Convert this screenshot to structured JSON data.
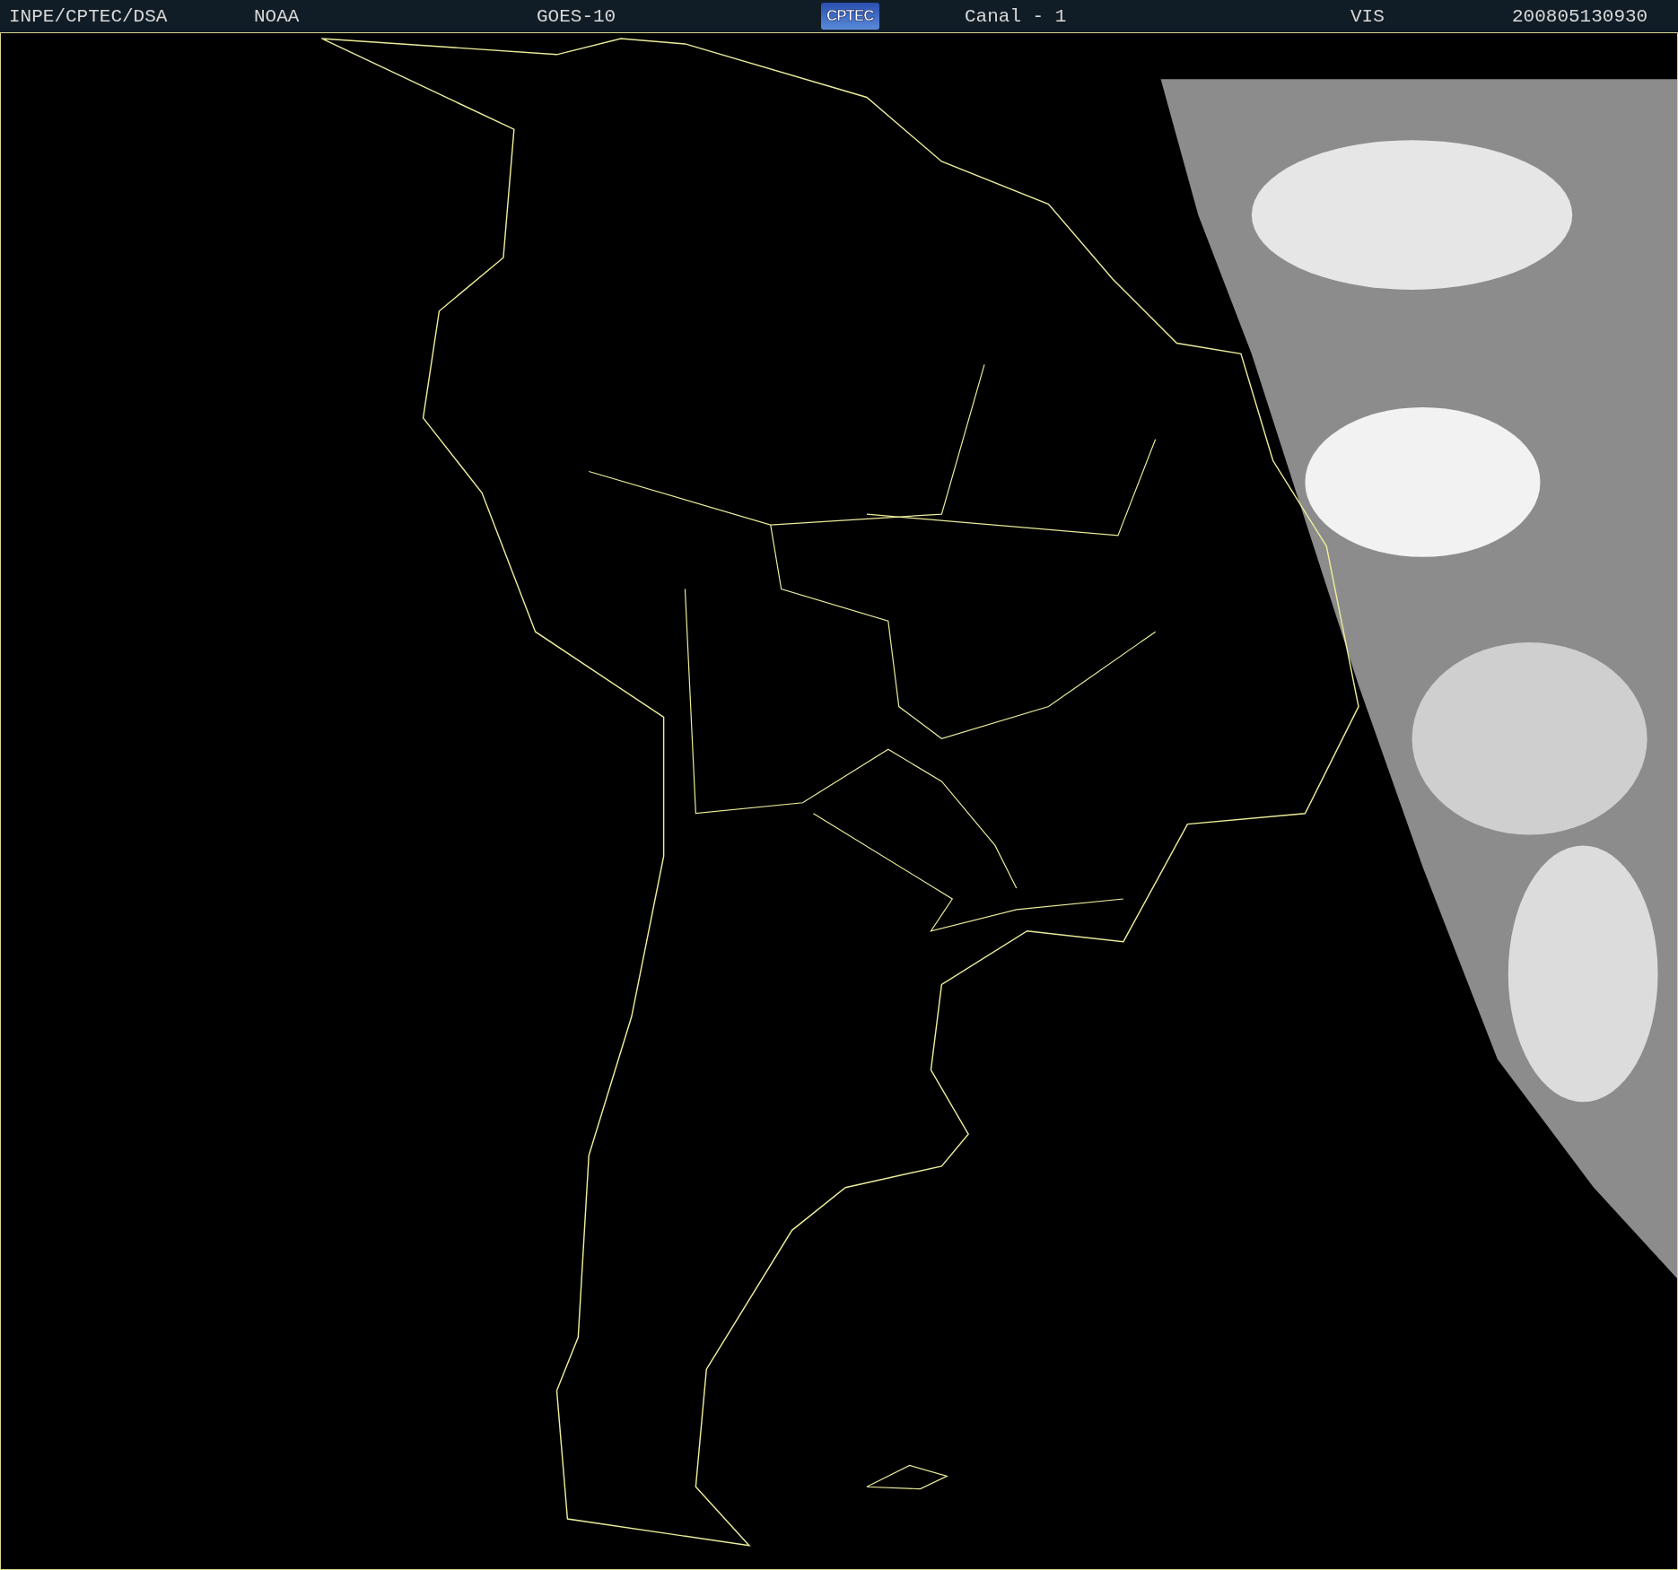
{
  "header": {
    "items": [
      {
        "kind": "text",
        "text": "INPE/CPTEC/DSA"
      },
      {
        "kind": "text",
        "text": "NOAA"
      },
      {
        "kind": "text",
        "text": "GOES-10"
      },
      {
        "kind": "logo",
        "text": "CPTEC"
      },
      {
        "kind": "text",
        "text": "Canal - 1"
      },
      {
        "kind": "text",
        "text": "VIS"
      },
      {
        "kind": "text",
        "text": "200805130930"
      }
    ]
  }
}
